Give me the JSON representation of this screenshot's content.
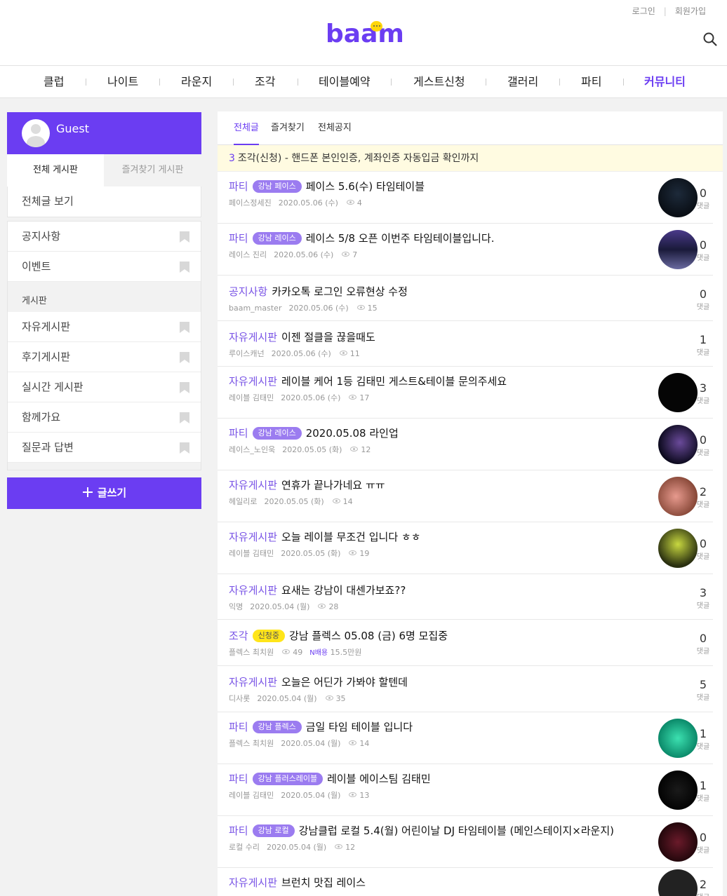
{
  "header": {
    "login": "로그인",
    "signup": "회원가입",
    "logo": "baam"
  },
  "nav": [
    "클럽",
    "나이트",
    "라운지",
    "조각",
    "테이블예약",
    "게스트신청",
    "갤러리",
    "파티",
    "커뮤니티"
  ],
  "sidebar": {
    "user": "Guest",
    "tabs": [
      "전체 게시판",
      "즐겨찾기 게시판"
    ],
    "all_posts": "전체글 보기",
    "group1": [
      "공지사항",
      "이벤트"
    ],
    "board_header": "게시판",
    "group2": [
      "자유게시판",
      "후기게시판",
      "실시간 게시판",
      "함께가요",
      "질문과 답변"
    ],
    "write_button": "글쓰기"
  },
  "main": {
    "tabs": [
      "전체글",
      "즐겨찾기",
      "전체공지"
    ],
    "notice_num": "3",
    "notice_text": "조각(신청) - 핸드폰 본인인증, 계좌인증 자동입금 확인까지",
    "comment_label": "댓글",
    "posts": [
      {
        "cat": "파티",
        "tag": "강남 페이스",
        "title": "페이스 5.6(수) 타임테이블",
        "author": "페이스정세진",
        "date": "2020.05.06 (수)",
        "views": "4",
        "comments": "0"
      },
      {
        "cat": "파티",
        "tag": "강남 레이스",
        "title": "레이스 5/8 오픈 이번주 타임테이블입니다.",
        "author": "레이스 진리",
        "date": "2020.05.06 (수)",
        "views": "7",
        "comments": "0"
      },
      {
        "cat": "공지사항",
        "tag": "",
        "title": "카카오톡 로그인 오류현상 수정",
        "author": "baam_master",
        "date": "2020.05.06 (수)",
        "views": "15",
        "comments": "0"
      },
      {
        "cat": "자유게시판",
        "tag": "",
        "title": "이젠 절클을 끊을때도",
        "author": "루이스캐넌",
        "date": "2020.05.06 (수)",
        "views": "11",
        "comments": "1"
      },
      {
        "cat": "자유게시판",
        "tag": "",
        "title": "레이블 케어 1등 김태민 게스트&테이블 문의주세요",
        "author": "레이블 김태민",
        "date": "2020.05.06 (수)",
        "views": "17",
        "comments": "3"
      },
      {
        "cat": "파티",
        "tag": "강남 레이스",
        "title": "2020.05.08 라인업",
        "author": "레이스_노인욱",
        "date": "2020.05.05 (화)",
        "views": "12",
        "comments": "0"
      },
      {
        "cat": "자유게시판",
        "tag": "",
        "title": "연휴가 끝나가네요 ㅠㅠ",
        "author": "헤일리로",
        "date": "2020.05.05 (화)",
        "views": "14",
        "comments": "2"
      },
      {
        "cat": "자유게시판",
        "tag": "",
        "title": "오늘 레이블 무조건 입니다 ㅎㅎ",
        "author": "레이블 김태민",
        "date": "2020.05.05 (화)",
        "views": "19",
        "comments": "0"
      },
      {
        "cat": "자유게시판",
        "tag": "",
        "title": "요새는 강남이 대센가보죠??",
        "author": "익명",
        "date": "2020.05.04 (월)",
        "views": "28",
        "comments": "3"
      },
      {
        "cat": "조각",
        "tag": "신청중",
        "title": "강남 플렉스 05.08 (금) 6명 모집중",
        "author": "플렉스 최치원",
        "date": "",
        "views": "49",
        "extra_label": "N배용",
        "extra_value": "15.5만원",
        "comments": "0"
      },
      {
        "cat": "자유게시판",
        "tag": "",
        "title": "오늘은 어딘가 가봐야 할텐데",
        "author": "디사롯",
        "date": "2020.05.04 (월)",
        "views": "35",
        "comments": "5"
      },
      {
        "cat": "파티",
        "tag": "강남 플렉스",
        "title": "금일 타임 테이블 입니다",
        "author": "플렉스 최치원",
        "date": "2020.05.04 (월)",
        "views": "14",
        "comments": "1"
      },
      {
        "cat": "파티",
        "tag": "강남 플러스레이블",
        "title": "레이블 에이스팀 김태민",
        "author": "레이블 김태민",
        "date": "2020.05.04 (월)",
        "views": "13",
        "comments": "1"
      },
      {
        "cat": "파티",
        "tag": "강남 로컬",
        "title": "강남클럽 로컬 5.4(월) 어린이날 DJ 타임테이블 (메인스테이지×라운지)",
        "author": "로컬 수리",
        "date": "2020.05.04 (월)",
        "views": "12",
        "comments": "0"
      },
      {
        "cat": "자유게시판",
        "tag": "",
        "title": "브런치 맛집 레이스",
        "author": "",
        "date": "",
        "views": "",
        "comments": "2"
      }
    ]
  },
  "colors": {
    "brand": "#6b3df2",
    "tag": "#9b7cf0",
    "notice_bg": "#fffbe1",
    "highlight_tag": "#ffe51a"
  }
}
